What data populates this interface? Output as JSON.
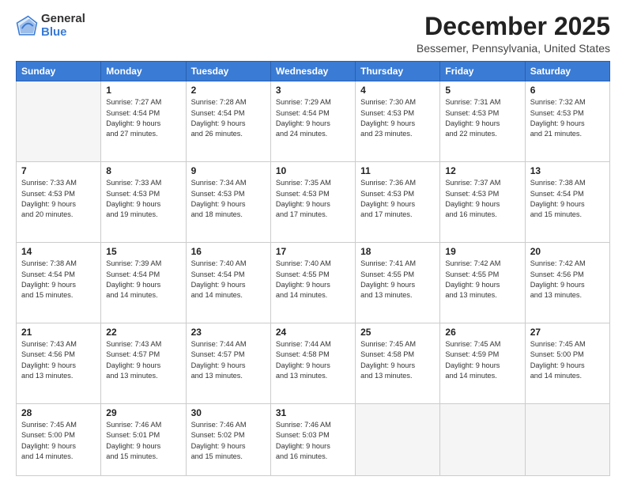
{
  "logo": {
    "general": "General",
    "blue": "Blue"
  },
  "header": {
    "month": "December 2025",
    "location": "Bessemer, Pennsylvania, United States"
  },
  "weekdays": [
    "Sunday",
    "Monday",
    "Tuesday",
    "Wednesday",
    "Thursday",
    "Friday",
    "Saturday"
  ],
  "weeks": [
    [
      {
        "day": "",
        "info": ""
      },
      {
        "day": "1",
        "info": "Sunrise: 7:27 AM\nSunset: 4:54 PM\nDaylight: 9 hours\nand 27 minutes."
      },
      {
        "day": "2",
        "info": "Sunrise: 7:28 AM\nSunset: 4:54 PM\nDaylight: 9 hours\nand 26 minutes."
      },
      {
        "day": "3",
        "info": "Sunrise: 7:29 AM\nSunset: 4:54 PM\nDaylight: 9 hours\nand 24 minutes."
      },
      {
        "day": "4",
        "info": "Sunrise: 7:30 AM\nSunset: 4:53 PM\nDaylight: 9 hours\nand 23 minutes."
      },
      {
        "day": "5",
        "info": "Sunrise: 7:31 AM\nSunset: 4:53 PM\nDaylight: 9 hours\nand 22 minutes."
      },
      {
        "day": "6",
        "info": "Sunrise: 7:32 AM\nSunset: 4:53 PM\nDaylight: 9 hours\nand 21 minutes."
      }
    ],
    [
      {
        "day": "7",
        "info": "Sunrise: 7:33 AM\nSunset: 4:53 PM\nDaylight: 9 hours\nand 20 minutes."
      },
      {
        "day": "8",
        "info": "Sunrise: 7:33 AM\nSunset: 4:53 PM\nDaylight: 9 hours\nand 19 minutes."
      },
      {
        "day": "9",
        "info": "Sunrise: 7:34 AM\nSunset: 4:53 PM\nDaylight: 9 hours\nand 18 minutes."
      },
      {
        "day": "10",
        "info": "Sunrise: 7:35 AM\nSunset: 4:53 PM\nDaylight: 9 hours\nand 17 minutes."
      },
      {
        "day": "11",
        "info": "Sunrise: 7:36 AM\nSunset: 4:53 PM\nDaylight: 9 hours\nand 17 minutes."
      },
      {
        "day": "12",
        "info": "Sunrise: 7:37 AM\nSunset: 4:53 PM\nDaylight: 9 hours\nand 16 minutes."
      },
      {
        "day": "13",
        "info": "Sunrise: 7:38 AM\nSunset: 4:54 PM\nDaylight: 9 hours\nand 15 minutes."
      }
    ],
    [
      {
        "day": "14",
        "info": "Sunrise: 7:38 AM\nSunset: 4:54 PM\nDaylight: 9 hours\nand 15 minutes."
      },
      {
        "day": "15",
        "info": "Sunrise: 7:39 AM\nSunset: 4:54 PM\nDaylight: 9 hours\nand 14 minutes."
      },
      {
        "day": "16",
        "info": "Sunrise: 7:40 AM\nSunset: 4:54 PM\nDaylight: 9 hours\nand 14 minutes."
      },
      {
        "day": "17",
        "info": "Sunrise: 7:40 AM\nSunset: 4:55 PM\nDaylight: 9 hours\nand 14 minutes."
      },
      {
        "day": "18",
        "info": "Sunrise: 7:41 AM\nSunset: 4:55 PM\nDaylight: 9 hours\nand 13 minutes."
      },
      {
        "day": "19",
        "info": "Sunrise: 7:42 AM\nSunset: 4:55 PM\nDaylight: 9 hours\nand 13 minutes."
      },
      {
        "day": "20",
        "info": "Sunrise: 7:42 AM\nSunset: 4:56 PM\nDaylight: 9 hours\nand 13 minutes."
      }
    ],
    [
      {
        "day": "21",
        "info": "Sunrise: 7:43 AM\nSunset: 4:56 PM\nDaylight: 9 hours\nand 13 minutes."
      },
      {
        "day": "22",
        "info": "Sunrise: 7:43 AM\nSunset: 4:57 PM\nDaylight: 9 hours\nand 13 minutes."
      },
      {
        "day": "23",
        "info": "Sunrise: 7:44 AM\nSunset: 4:57 PM\nDaylight: 9 hours\nand 13 minutes."
      },
      {
        "day": "24",
        "info": "Sunrise: 7:44 AM\nSunset: 4:58 PM\nDaylight: 9 hours\nand 13 minutes."
      },
      {
        "day": "25",
        "info": "Sunrise: 7:45 AM\nSunset: 4:58 PM\nDaylight: 9 hours\nand 13 minutes."
      },
      {
        "day": "26",
        "info": "Sunrise: 7:45 AM\nSunset: 4:59 PM\nDaylight: 9 hours\nand 14 minutes."
      },
      {
        "day": "27",
        "info": "Sunrise: 7:45 AM\nSunset: 5:00 PM\nDaylight: 9 hours\nand 14 minutes."
      }
    ],
    [
      {
        "day": "28",
        "info": "Sunrise: 7:45 AM\nSunset: 5:00 PM\nDaylight: 9 hours\nand 14 minutes."
      },
      {
        "day": "29",
        "info": "Sunrise: 7:46 AM\nSunset: 5:01 PM\nDaylight: 9 hours\nand 15 minutes."
      },
      {
        "day": "30",
        "info": "Sunrise: 7:46 AM\nSunset: 5:02 PM\nDaylight: 9 hours\nand 15 minutes."
      },
      {
        "day": "31",
        "info": "Sunrise: 7:46 AM\nSunset: 5:03 PM\nDaylight: 9 hours\nand 16 minutes."
      },
      {
        "day": "",
        "info": ""
      },
      {
        "day": "",
        "info": ""
      },
      {
        "day": "",
        "info": ""
      }
    ]
  ]
}
